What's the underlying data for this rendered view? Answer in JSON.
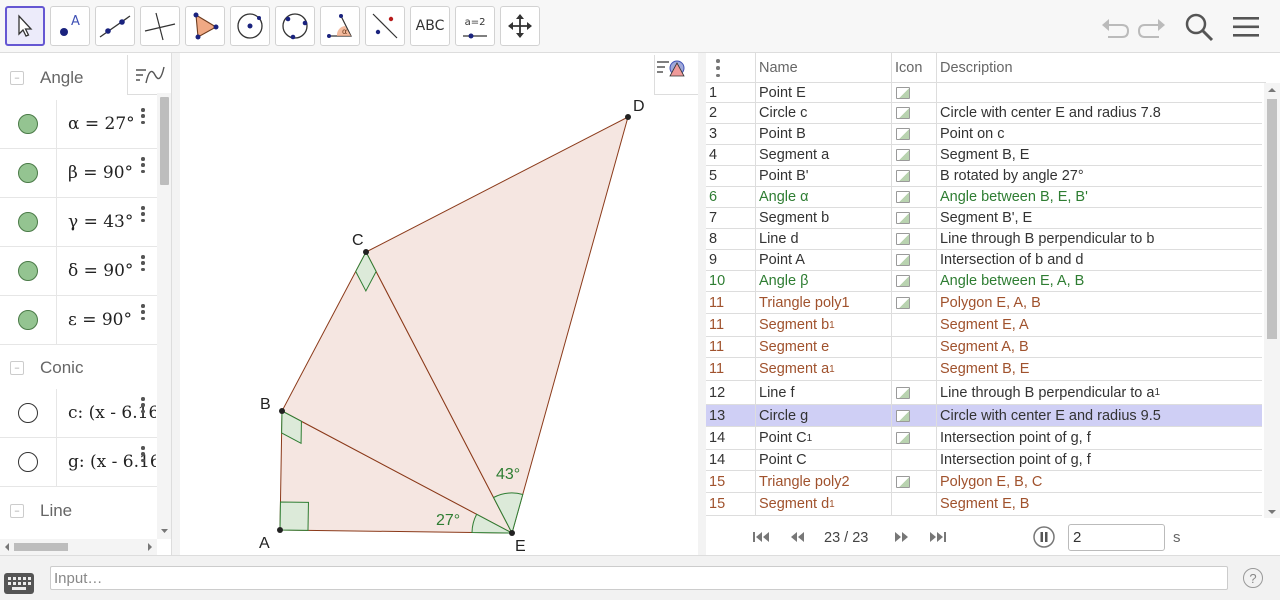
{
  "toolbar": {
    "tools": [
      {
        "name": "move-tool",
        "active": true
      },
      {
        "name": "point-tool"
      },
      {
        "name": "line-tool"
      },
      {
        "name": "perpendicular-line-tool"
      },
      {
        "name": "polygon-tool"
      },
      {
        "name": "circle-center-point-tool"
      },
      {
        "name": "circle-three-points-tool"
      },
      {
        "name": "angle-tool"
      },
      {
        "name": "reflect-tool"
      },
      {
        "name": "text-tool",
        "label": "ABC"
      },
      {
        "name": "slider-tool",
        "label": "a=2"
      },
      {
        "name": "move-graphics-view-tool"
      }
    ]
  },
  "algebra": {
    "groups": {
      "angle": "Angle",
      "conic": "Conic",
      "line": "Line"
    },
    "angle_items": [
      {
        "text": "α = 27°",
        "visible": true
      },
      {
        "text": "β = 90°",
        "visible": true
      },
      {
        "text": "γ = 43°",
        "visible": true
      },
      {
        "text": "δ = 90°",
        "visible": true
      },
      {
        "text": "ε = 90°",
        "visible": true
      }
    ],
    "conic_items": [
      {
        "text": "c: (x - 6.16",
        "visible": false
      },
      {
        "text": "g: (x - 6.16",
        "visible": false
      }
    ]
  },
  "graphics": {
    "point_labels": {
      "A": "A",
      "B": "B",
      "C": "C",
      "D": "D",
      "E": "E"
    },
    "angle_labels": {
      "alpha": "27°",
      "gamma": "43°"
    },
    "colors": {
      "fill": "#f5e6e1",
      "edge": "#8b3a1a",
      "angle": "#2e7d32",
      "angle_fill": "#dcead9"
    }
  },
  "protocol": {
    "headers": {
      "name": "Name",
      "icon": "Icon",
      "description": "Description"
    },
    "rows": [
      {
        "num": "1",
        "name": "Point E",
        "desc": "",
        "icon": true,
        "color": "#333333"
      },
      {
        "num": "2",
        "name": "Circle c",
        "desc": "Circle with center E and radius 7.8",
        "icon": true,
        "color": "#333333"
      },
      {
        "num": "3",
        "name": "Point B",
        "desc": "Point on c",
        "icon": true,
        "color": "#333333"
      },
      {
        "num": "4",
        "name": "Segment a",
        "desc": "Segment B, E",
        "icon": true,
        "color": "#333333"
      },
      {
        "num": "5",
        "name": "Point B'",
        "desc": "B rotated by angle 27°",
        "icon": true,
        "color": "#333333"
      },
      {
        "num": "6",
        "name": "Angle α",
        "desc": "Angle between B, E, B'",
        "icon": true,
        "color": "#2e7d32"
      },
      {
        "num": "7",
        "name": "Segment b",
        "desc": "Segment B', E",
        "icon": true,
        "color": "#333333"
      },
      {
        "num": "8",
        "name": "Line d",
        "desc": "Line through B perpendicular to b",
        "icon": true,
        "color": "#333333"
      },
      {
        "num": "9",
        "name": "Point A",
        "desc": "Intersection of b and d",
        "icon": true,
        "color": "#333333"
      },
      {
        "num": "10",
        "name": "Angle β",
        "desc": "Angle between E, A, B",
        "icon": true,
        "color": "#2e7d32"
      },
      {
        "num": "11",
        "name": "Triangle poly1",
        "desc": "Polygon E, A, B",
        "icon": true,
        "color": "#a0522d"
      },
      {
        "num": "11",
        "name": "Segment b",
        "sub": "1",
        "desc": "Segment E, A",
        "icon": false,
        "color": "#a0522d"
      },
      {
        "num": "11",
        "name": "Segment e",
        "desc": "Segment A, B",
        "icon": false,
        "color": "#a0522d"
      },
      {
        "num": "11",
        "name": "Segment a",
        "sub": "1",
        "desc": "Segment B, E",
        "icon": false,
        "color": "#a0522d"
      },
      {
        "num": "12",
        "name": "Line f",
        "desc": "Line through B perpendicular to a",
        "desc_sub": "1",
        "icon": true,
        "color": "#333333"
      },
      {
        "num": "13",
        "name": "Circle g",
        "desc": "Circle with center E and radius 9.5",
        "icon": true,
        "color": "#333333",
        "selected": true
      },
      {
        "num": "14",
        "name": "Point C",
        "sub": "1",
        "desc": "Intersection point of g, f",
        "icon": true,
        "color": "#333333"
      },
      {
        "num": "14",
        "name": "Point C",
        "desc": "Intersection point of g, f",
        "icon": false,
        "color": "#333333"
      },
      {
        "num": "15",
        "name": "Triangle poly2",
        "desc": "Polygon E, B, C",
        "icon": true,
        "color": "#a0522d"
      },
      {
        "num": "15",
        "name": "Segment d",
        "sub": "1",
        "desc": "Segment E, B",
        "icon": false,
        "color": "#a0522d"
      }
    ],
    "navigation": {
      "counter": "23 / 23",
      "speed": "2",
      "unit": "s"
    }
  },
  "input_bar": {
    "placeholder": "Input…",
    "help": "?"
  }
}
